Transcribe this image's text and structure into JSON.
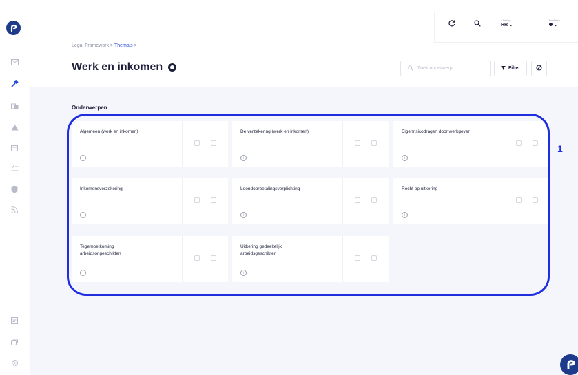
{
  "header": {
    "afdeling_label": "Afdeling",
    "afdeling_value": "HR",
    "profielen_label": "Profielen"
  },
  "breadcrumb": {
    "root": "Legal Framework",
    "sep1": ">",
    "current": "Thema's",
    "sep2": ">"
  },
  "page": {
    "title": "Werk en inkomen"
  },
  "toolbar": {
    "search_placeholder": "Zoek onderwerp...",
    "filter_label": "Filter"
  },
  "section": {
    "title": "Onderwerpen"
  },
  "cards": [
    {
      "title": "Algemeen (werk en inkomen)"
    },
    {
      "title": "De verzekering (werk en inkomen)"
    },
    {
      "title": "Eigenrisicodragen door werkgever"
    },
    {
      "title": "Inkomensverzekering"
    },
    {
      "title": "Loondoorbetalingsverplichting"
    },
    {
      "title": "Recht op uitkering"
    },
    {
      "title": "Tegemoetkoming arbeidsongeschikten"
    },
    {
      "title": "Uitkering gedeeltelijk arbeidsgeschikten"
    }
  ],
  "annotation": {
    "marker": "1",
    "color": "#1f2fe0"
  },
  "icons": {
    "sidebar": [
      "mail-icon",
      "hammer-icon",
      "folders-icon",
      "warning-icon",
      "calendar-icon",
      "checklist-icon",
      "shield-icon",
      "rss-icon",
      "list-icon",
      "copy-icon",
      "gear-icon"
    ],
    "top": [
      "refresh-icon",
      "search-icon"
    ]
  }
}
